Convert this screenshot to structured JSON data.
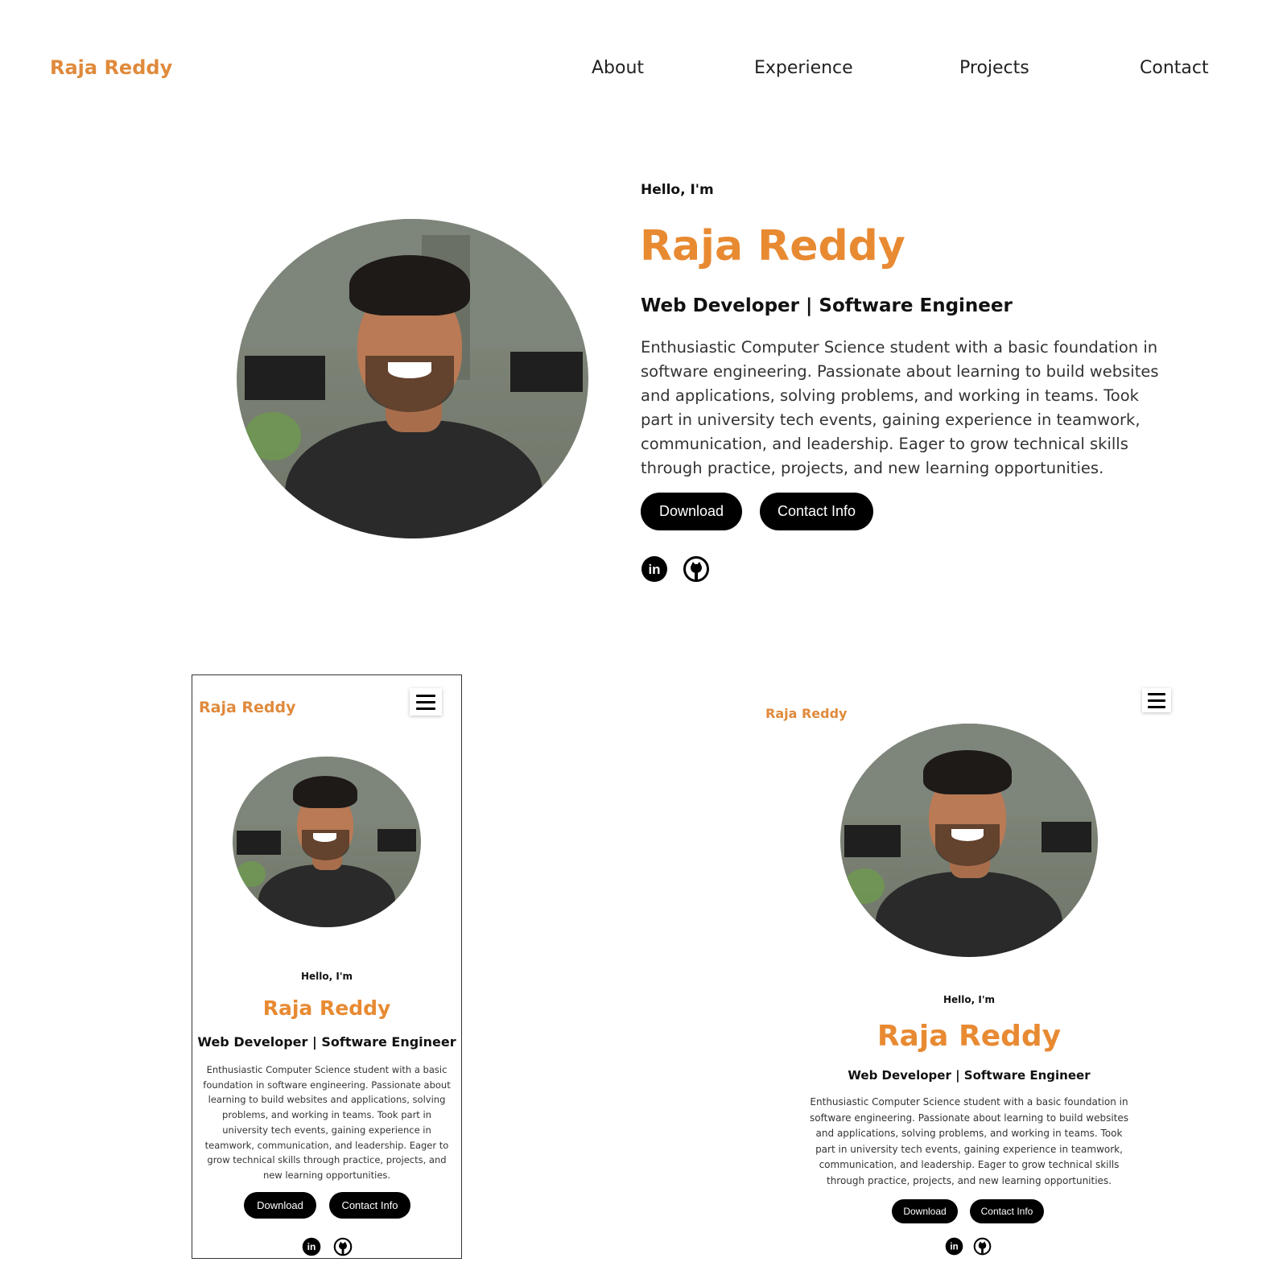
{
  "desktop": {
    "brand": "Raja Reddy",
    "nav": [
      "About",
      "Experience",
      "Projects",
      "Contact"
    ],
    "hero": {
      "greeting": "Hello, I'm",
      "name": "Raja Reddy",
      "role": "Web Developer | Software Engineer",
      "bio_lines": [
        "Enthusiastic Computer Science student with a basic foundation in",
        "software engineering. Passionate about learning to build websites",
        "and applications, solving problems, and working in teams. Took",
        "part in university tech events, gaining experience in teamwork,",
        "communication, and leadership. Eager to grow technical skills",
        "through practice, projects, and new learning opportunities."
      ],
      "download_label": "Download",
      "contact_label": "Contact Info"
    }
  },
  "mobile": {
    "brand": "Raja Reddy",
    "greeting": "Hello, I'm",
    "name": "Raja Reddy",
    "role": "Web Developer | Software Engineer",
    "bio_lines": [
      "Enthusiastic Computer Science student with a basic",
      "foundation in software engineering. Passionate about",
      "learning to build websites and applications, solving",
      "problems, and working in teams. Took part in",
      "university tech events, gaining experience in",
      "teamwork, communication, and leadership. Eager to",
      "grow technical skills through practice, projects, and",
      "new learning opportunities."
    ],
    "download_label": "Download",
    "contact_label": "Contact Info"
  },
  "tablet": {
    "brand": "Raja Reddy",
    "greeting": "Hello, I'm",
    "name": "Raja Reddy",
    "role": "Web Developer | Software Engineer",
    "bio_lines": [
      "Enthusiastic Computer Science student with a basic foundation in",
      "software engineering. Passionate about learning to build websites",
      "and applications, solving problems, and working in teams. Took",
      "part in university tech events, gaining experience in teamwork,",
      "communication, and leadership. Eager to grow technical skills",
      "through practice, projects, and new learning opportunities."
    ],
    "download_label": "Download",
    "contact_label": "Contact Info"
  },
  "icons": [
    "linkedin-icon",
    "github-icon",
    "hamburger-menu-icon"
  ],
  "colors": {
    "brand": "#e08a3c",
    "name": "#e88a32",
    "button": "#000000",
    "text": "#111111"
  }
}
